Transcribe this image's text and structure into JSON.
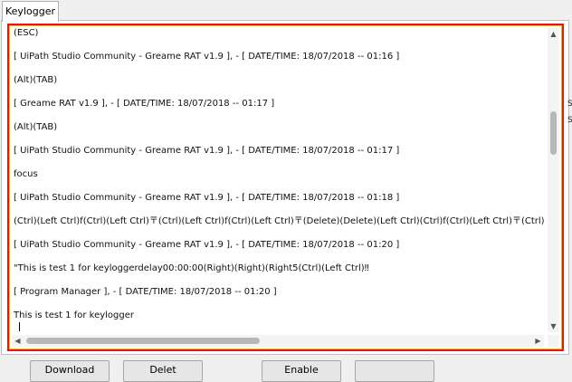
{
  "tab": {
    "label": "Keylogger"
  },
  "log": {
    "lines": [
      "(ESC)",
      "[ UiPath Studio Community - Greame RAT v1.9 ], -  [ DATE/TIME: 18/07/2018 -- 01:16 ]",
      "(Alt)(TAB)",
      "[ Greame RAT v1.9 ], -  [ DATE/TIME: 18/07/2018 -- 01:17 ]",
      "(Alt)(TAB)",
      "[ UiPath Studio Community - Greame RAT v1.9 ], -  [ DATE/TIME: 18/07/2018 -- 01:17 ]",
      "focus",
      "[ UiPath Studio Community - Greame RAT v1.9 ], -  [ DATE/TIME: 18/07/2018 -- 01:18 ]",
      "(Ctrl)(Left Ctrl)f(Ctrl)(Left Ctrl)〒(Ctrl)(Left Ctrl)f(Ctrl)(Left Ctrl)〒(Delete)(Delete)(Left Ctrl)(Ctrl)f(Ctrl)(Left Ctrl)〒(Ctrl)(Le",
      "[ UiPath Studio Community - Greame RAT v1.9 ], -  [ DATE/TIME: 18/07/2018 -- 01:20 ]",
      "\"This is test 1 for keyloggerdelay00:00:00(Right)(Right)(Right5(Ctrl)(Left Ctrl)‼",
      "[ Program Manager ], -  [ DATE/TIME: 18/07/2018 -- 01:20 ]",
      "This is test 1 for keylogger"
    ]
  },
  "buttons": {
    "download_label": "Download",
    "b2_label": "Delet",
    "b3_label": "Enable",
    "b4_label": ""
  },
  "side_fragments": {
    "a": "S",
    "b": "S"
  },
  "icons": {
    "scroll_up": "▲",
    "scroll_down": "▼",
    "scroll_left": "◀",
    "scroll_right": "▶"
  },
  "colors": {
    "frame_border": "#e8141a",
    "frame_inner": "#d9c800"
  }
}
